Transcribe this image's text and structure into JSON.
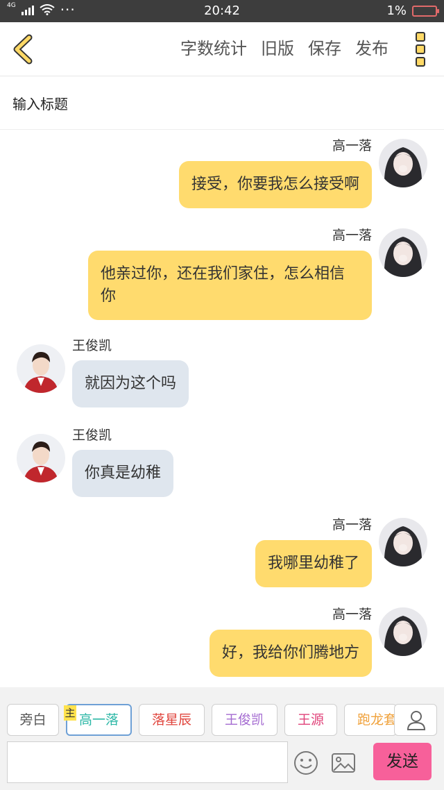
{
  "status_bar": {
    "network": "4G",
    "time": "20:42",
    "battery": "1%",
    "more": "···"
  },
  "header": {
    "actions": [
      "字数统计",
      "旧版",
      "保存",
      "发布"
    ]
  },
  "title_input": {
    "placeholder": "输入标题"
  },
  "messages": [
    {
      "speaker": "高一落",
      "side": "right",
      "text": "接受，你要我怎么接受啊"
    },
    {
      "speaker": "高一落",
      "side": "right",
      "text": "他亲过你，还在我们家住，怎么相信你"
    },
    {
      "speaker": "王俊凯",
      "side": "left",
      "text": "就因为这个吗"
    },
    {
      "speaker": "王俊凯",
      "side": "left",
      "text": "你真是幼稚"
    },
    {
      "speaker": "高一落",
      "side": "right",
      "text": "我哪里幼稚了"
    },
    {
      "speaker": "高一落",
      "side": "right",
      "text": "好，我给你们腾地方"
    }
  ],
  "roles": {
    "main_tag": "主",
    "items": [
      {
        "label": "旁白",
        "color": "#555555"
      },
      {
        "label": "高一落",
        "color": "#2bb7a6"
      },
      {
        "label": "落星辰",
        "color": "#e0443c"
      },
      {
        "label": "王俊凯",
        "color": "#a46bd1"
      },
      {
        "label": "王源",
        "color": "#e0437a"
      },
      {
        "label": "跑龙套",
        "color": "#f0a23c"
      }
    ]
  },
  "composer": {
    "send_label": "发送"
  },
  "colors": {
    "accent": "#ffdb6e",
    "send": "#f7609a",
    "left_bubble": "#dfe6ee"
  }
}
